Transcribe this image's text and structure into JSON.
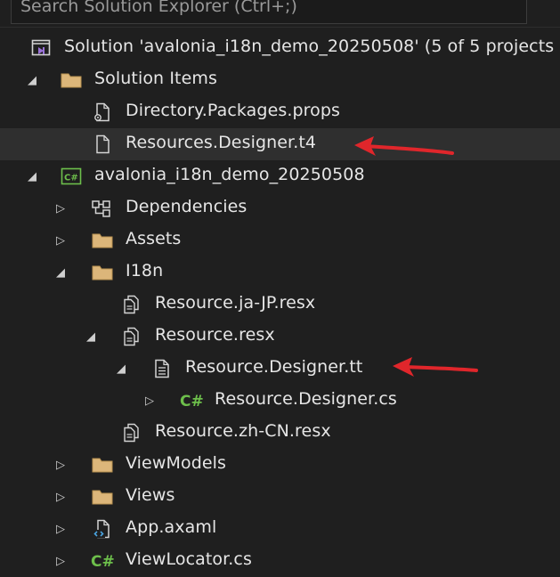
{
  "search": {
    "placeholder": "Search Solution Explorer (Ctrl+;)"
  },
  "colors": {
    "background": "#1f1f1f",
    "selection": "#2f2f2f",
    "folder": "#dcb67a",
    "csharp": "#6dbf4b",
    "vs_purple": "#9b73d8",
    "annotation_arrow": "#e0262b"
  },
  "tree": [
    {
      "label": "Solution 'avalonia_i18n_demo_20250508' (5 of 5 projects",
      "icon": "solution-icon",
      "expander": "none"
    },
    {
      "label": "Solution Items",
      "icon": "folder-icon",
      "expander": "expanded"
    },
    {
      "label": "Directory.Packages.props",
      "icon": "props-file-icon",
      "expander": "none"
    },
    {
      "label": "Resources.Designer.t4",
      "icon": "file-icon",
      "expander": "none",
      "selected": true
    },
    {
      "label": "avalonia_i18n_demo_20250508",
      "icon": "csharp-project-icon",
      "expander": "expanded"
    },
    {
      "label": "Dependencies",
      "icon": "dependencies-icon",
      "expander": "collapsed"
    },
    {
      "label": "Assets",
      "icon": "folder-icon",
      "expander": "collapsed"
    },
    {
      "label": "I18n",
      "icon": "folder-icon",
      "expander": "expanded"
    },
    {
      "label": "Resource.ja-JP.resx",
      "icon": "resx-icon",
      "expander": "none"
    },
    {
      "label": "Resource.resx",
      "icon": "resx-icon",
      "expander": "expanded"
    },
    {
      "label": "Resource.Designer.tt",
      "icon": "text-template-icon",
      "expander": "expanded"
    },
    {
      "label": "Resource.Designer.cs",
      "icon": "csharp-file-icon",
      "expander": "collapsed"
    },
    {
      "label": "Resource.zh-CN.resx",
      "icon": "resx-icon",
      "expander": "none"
    },
    {
      "label": "ViewModels",
      "icon": "folder-icon",
      "expander": "collapsed"
    },
    {
      "label": "Views",
      "icon": "folder-icon",
      "expander": "collapsed"
    },
    {
      "label": "App.axaml",
      "icon": "xaml-file-icon",
      "expander": "collapsed"
    },
    {
      "label": "ViewLocator.cs",
      "icon": "csharp-file-icon",
      "expander": "collapsed"
    }
  ]
}
